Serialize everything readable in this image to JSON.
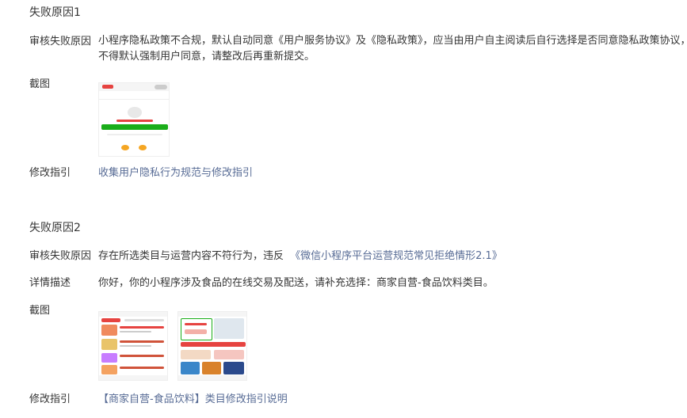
{
  "reason1": {
    "title": "失败原因1",
    "audit_label": "审核失败原因",
    "audit_text_line1": "小程序隐私政策不合规，默认自动同意《用户服务协议》及《隐私政策》，应当由用户自主阅读后自行选择是否同意隐私政策协议，",
    "audit_text_line2": "不得默认强制用户同意，请整改后再重新提交。",
    "screenshot_label": "截图",
    "fix_label": "修改指引",
    "fix_link": "收集用户隐私行为规范与修改指引"
  },
  "reason2": {
    "title": "失败原因2",
    "audit_label": "审核失败原因",
    "audit_text": "存在所选类目与运营内容不符行为，违反",
    "audit_link": "《微信小程序平台运营规范常见拒绝情形2.1》",
    "detail_label": "详情描述",
    "detail_text": "你好，你的小程序涉及食品的在线交易及配送，请补充选择：商家自营-食品饮料类目。",
    "screenshot_label": "截图",
    "fix_label": "修改指引",
    "fix_link": "【商家自营-食品饮料】类目修改指引说明"
  },
  "colors": {
    "text": "#353535",
    "link": "#576b95",
    "accent_green": "#1aad19",
    "accent_red": "#e64340"
  }
}
